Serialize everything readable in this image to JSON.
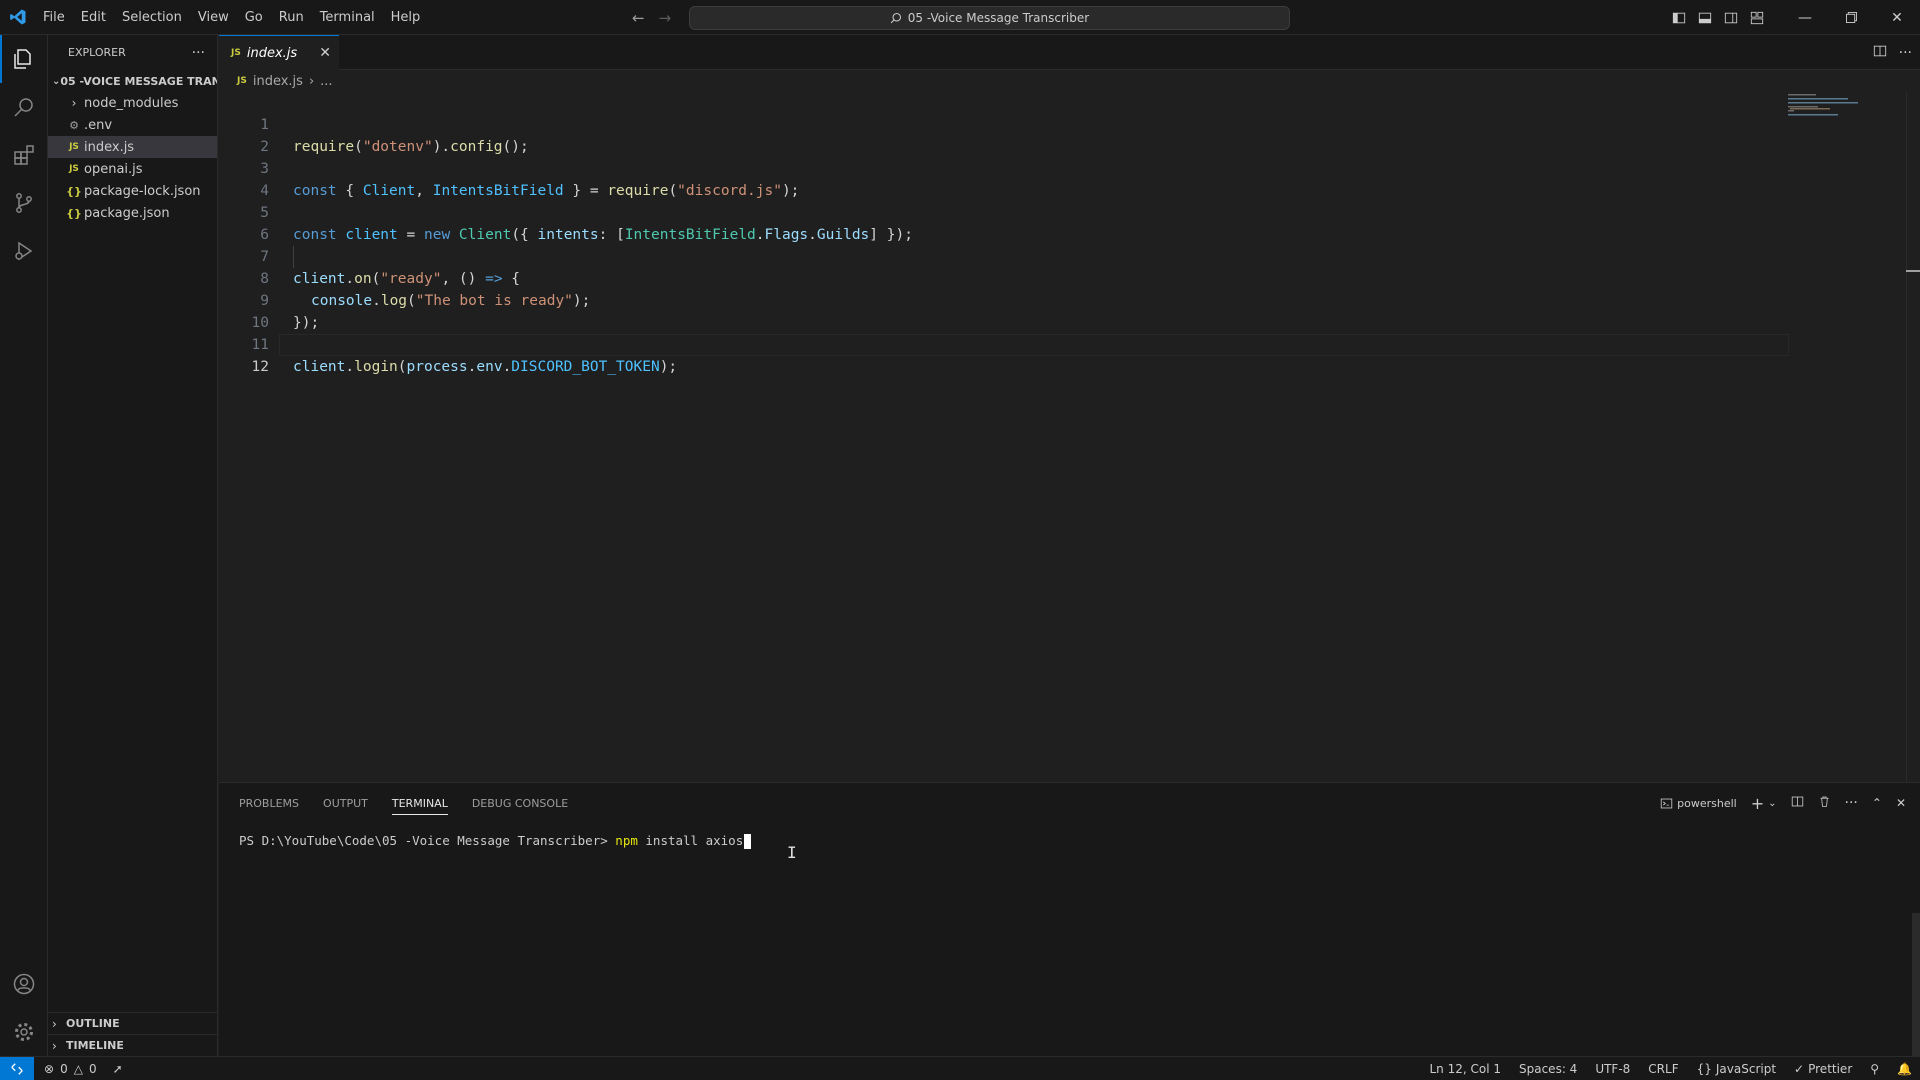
{
  "menu": [
    "File",
    "Edit",
    "Selection",
    "View",
    "Go",
    "Run",
    "Terminal",
    "Help"
  ],
  "command_center": "05 -Voice Message Transcriber",
  "sidebar": {
    "title": "EXPLORER",
    "folder": "05 -VOICE MESSAGE TRAN...",
    "items": [
      {
        "label": "node_modules",
        "icon": "chevron-right-icon"
      },
      {
        "label": ".env",
        "icon": "gear-icon"
      },
      {
        "label": "index.js",
        "icon": "js-icon"
      },
      {
        "label": "openai.js",
        "icon": "js-icon"
      },
      {
        "label": "package-lock.json",
        "icon": "json-icon"
      },
      {
        "label": "package.json",
        "icon": "json-icon"
      }
    ],
    "outline": "OUTLINE",
    "timeline": "TIMELINE"
  },
  "editor": {
    "tab_label": "index.js",
    "tab_badge": "JS",
    "breadcrumb_file": "index.js",
    "breadcrumb_more": "...",
    "line_numbers": [
      "1",
      "2",
      "3",
      "4",
      "5",
      "6",
      "7",
      "8",
      "9",
      "10",
      "11",
      "12"
    ],
    "code": {
      "l1": [
        "require",
        "(",
        "\"dotenv\"",
        ").",
        "config",
        "();"
      ],
      "l3": [
        "const",
        " { ",
        "Client",
        ", ",
        "IntentsBitField",
        " } = ",
        "require",
        "(",
        "\"discord.js\"",
        ");"
      ],
      "l5": [
        "const",
        " ",
        "client",
        " = ",
        "new",
        " ",
        "Client",
        "({ ",
        "intents",
        ": [",
        "IntentsBitField",
        ".",
        "Flags",
        ".",
        "Guilds",
        "] });"
      ],
      "l7": [
        "client",
        ".",
        "on",
        "(",
        "\"ready\"",
        ", () ",
        "=>",
        " {"
      ],
      "l8": [
        "console",
        ".",
        "log",
        "(",
        "\"The bot is ready\"",
        ");"
      ],
      "l9": [
        "});"
      ],
      "l11": [
        "client",
        ".",
        "login",
        "(",
        "process",
        ".",
        "env",
        ".",
        "DISCORD_BOT_TOKEN",
        ");"
      ]
    }
  },
  "panel": {
    "tabs": [
      "PROBLEMS",
      "OUTPUT",
      "TERMINAL",
      "DEBUG CONSOLE"
    ],
    "active_tab": "TERMINAL",
    "shell": "powershell",
    "prompt": "PS D:\\YouTube\\Code\\05 -Voice Message Transcriber> ",
    "cmd_npm": "npm",
    "cmd_rest": " install axios"
  },
  "status": {
    "errors": "0",
    "warnings": "0",
    "position": "Ln 12, Col 1",
    "spaces": "Spaces: 4",
    "encoding": "UTF-8",
    "eol": "CRLF",
    "language": "JavaScript",
    "formatter": "Prettier"
  },
  "colors": {
    "accent": "#0078d4",
    "keyword": "#569cd6",
    "string": "#ce9178",
    "function": "#dcdcaa",
    "variable": "#9cdcfe"
  }
}
